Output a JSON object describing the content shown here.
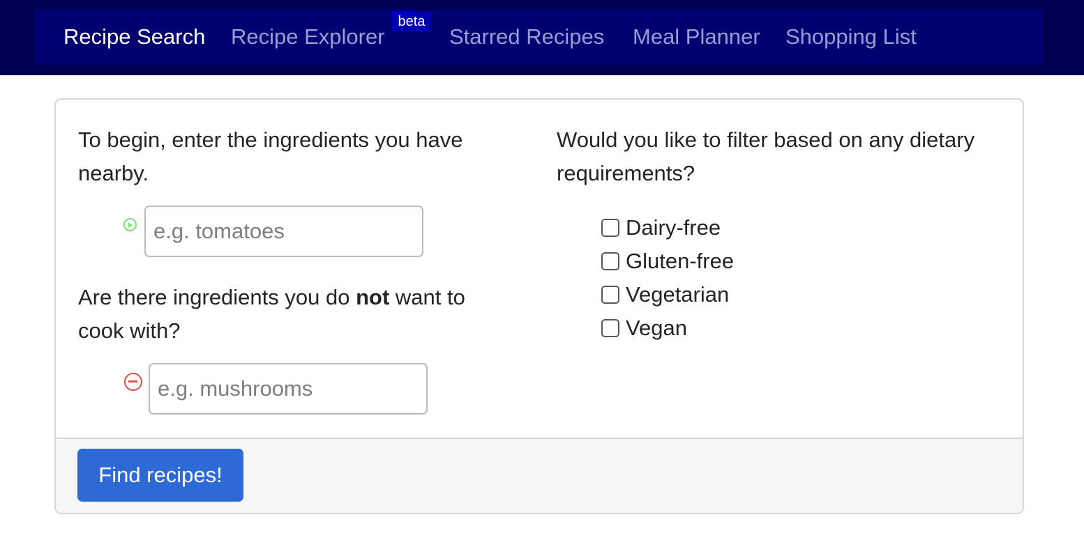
{
  "nav": {
    "items": [
      {
        "label": "Recipe Search"
      },
      {
        "label": "Recipe Explorer"
      },
      {
        "label": "Starred Recipes"
      },
      {
        "label": "Meal Planner"
      },
      {
        "label": "Shopping List"
      }
    ],
    "beta_badge": "beta",
    "active_item": "Recipe Search"
  },
  "include": {
    "prompt_line1": "To begin, enter the ingredients you have",
    "prompt_line2": "nearby.",
    "placeholder": "e.g. tomatoes",
    "value": ""
  },
  "exclude": {
    "prompt_before": "Are there ingredients you do ",
    "prompt_bold": "not",
    "prompt_after": " want to",
    "prompt_line2": "cook with?",
    "placeholder": "e.g. mushrooms",
    "value": ""
  },
  "dietary": {
    "prompt_line1": "Would you like to filter based on any dietary",
    "prompt_line2": "requirements?",
    "options": [
      {
        "label": "Dairy-free",
        "checked": false
      },
      {
        "label": "Gluten-free",
        "checked": false
      },
      {
        "label": "Vegetarian",
        "checked": false
      },
      {
        "label": "Vegan",
        "checked": false
      }
    ]
  },
  "actions": {
    "find_label": "Find recipes!"
  },
  "colors": {
    "navbar_outer": "#000051",
    "navbar_inner": "#000070",
    "nav_active": "#ffffff",
    "nav_inactive": "#9a9cd6",
    "badge_bg": "#0000b3",
    "primary": "#2d6ad6",
    "add_icon": "#7ddc7d",
    "remove_icon": "#d9534f"
  }
}
